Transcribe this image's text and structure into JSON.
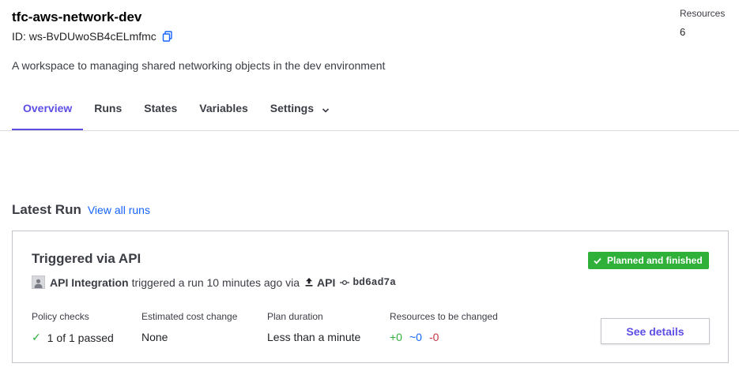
{
  "workspace": {
    "name": "tfc-aws-network-dev",
    "id_label": "ID: ws-BvDUwoSB4cELmfmc",
    "description": "A workspace to managing shared networking objects in the dev environment",
    "resources_label": "Resources",
    "resources_count": "6"
  },
  "tabs": [
    {
      "label": "Overview",
      "active": true
    },
    {
      "label": "Runs",
      "active": false
    },
    {
      "label": "States",
      "active": false
    },
    {
      "label": "Variables",
      "active": false
    },
    {
      "label": "Settings",
      "active": false,
      "icon": "chevron-down-icon"
    }
  ],
  "latest_run": {
    "heading": "Latest Run",
    "view_all_label": "View all runs",
    "title": "Triggered via API",
    "status": "Planned and finished",
    "status_color": "#2eb039",
    "actor": "API Integration",
    "action_text": "triggered a run 10 minutes ago via",
    "source": "API",
    "commit": "bd6ad7a",
    "stats": {
      "policy_label": "Policy checks",
      "policy_value": "1 of 1 passed",
      "cost_label": "Estimated cost change",
      "cost_value": "None",
      "duration_label": "Plan duration",
      "duration_value": "Less than a minute",
      "resources_label": "Resources to be changed",
      "add": "+0",
      "change": "~0",
      "destroy": "-0"
    },
    "details_button": "See details"
  },
  "colors": {
    "accent": "#5c4ee5",
    "link": "#1563ff",
    "success": "#2eb039",
    "danger": "#c73445"
  }
}
